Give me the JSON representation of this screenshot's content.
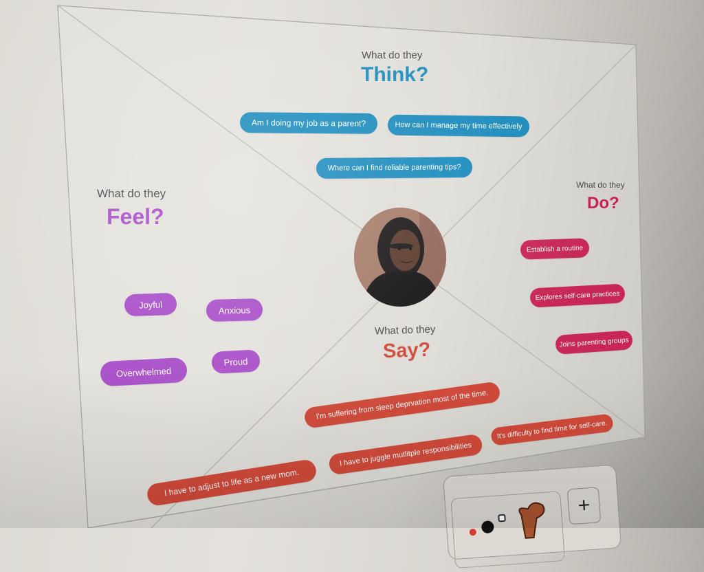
{
  "board": {
    "center_avatar": {
      "alt": "Persona photo: young woman in black hijab"
    },
    "quadrants": {
      "think": {
        "subtitle": "What do they",
        "title": "Think?",
        "color": "#1b8bbd",
        "items": [
          "Am I doing my job as a parent?",
          "How can I manage my time effectively",
          "Where can I find reliable parenting tips?"
        ]
      },
      "feel": {
        "subtitle": "What do they",
        "title": "Feel?",
        "color": "#a94ec9",
        "items": [
          "Joyful",
          "Anxious",
          "Overwhelmed",
          "Proud"
        ]
      },
      "do": {
        "subtitle": "What do they",
        "title": "Do?",
        "color": "#c81f4f",
        "items": [
          "Establish a routine",
          "Explores self-care practices",
          "Joins parenting groups"
        ]
      },
      "say": {
        "subtitle": "What do they",
        "title": "Say?",
        "color": "#d14a3a",
        "items": [
          "I'm suffering from sleep deprvation most of the time.",
          "It's difficulty to find time for self-care.",
          "I have to juggle mutlitple responsibilities",
          "I have to adjust to life as a new mom."
        ]
      }
    }
  },
  "toolbar": {
    "stickers_icon": "stickers-shapes-icon",
    "add_label": "+"
  }
}
